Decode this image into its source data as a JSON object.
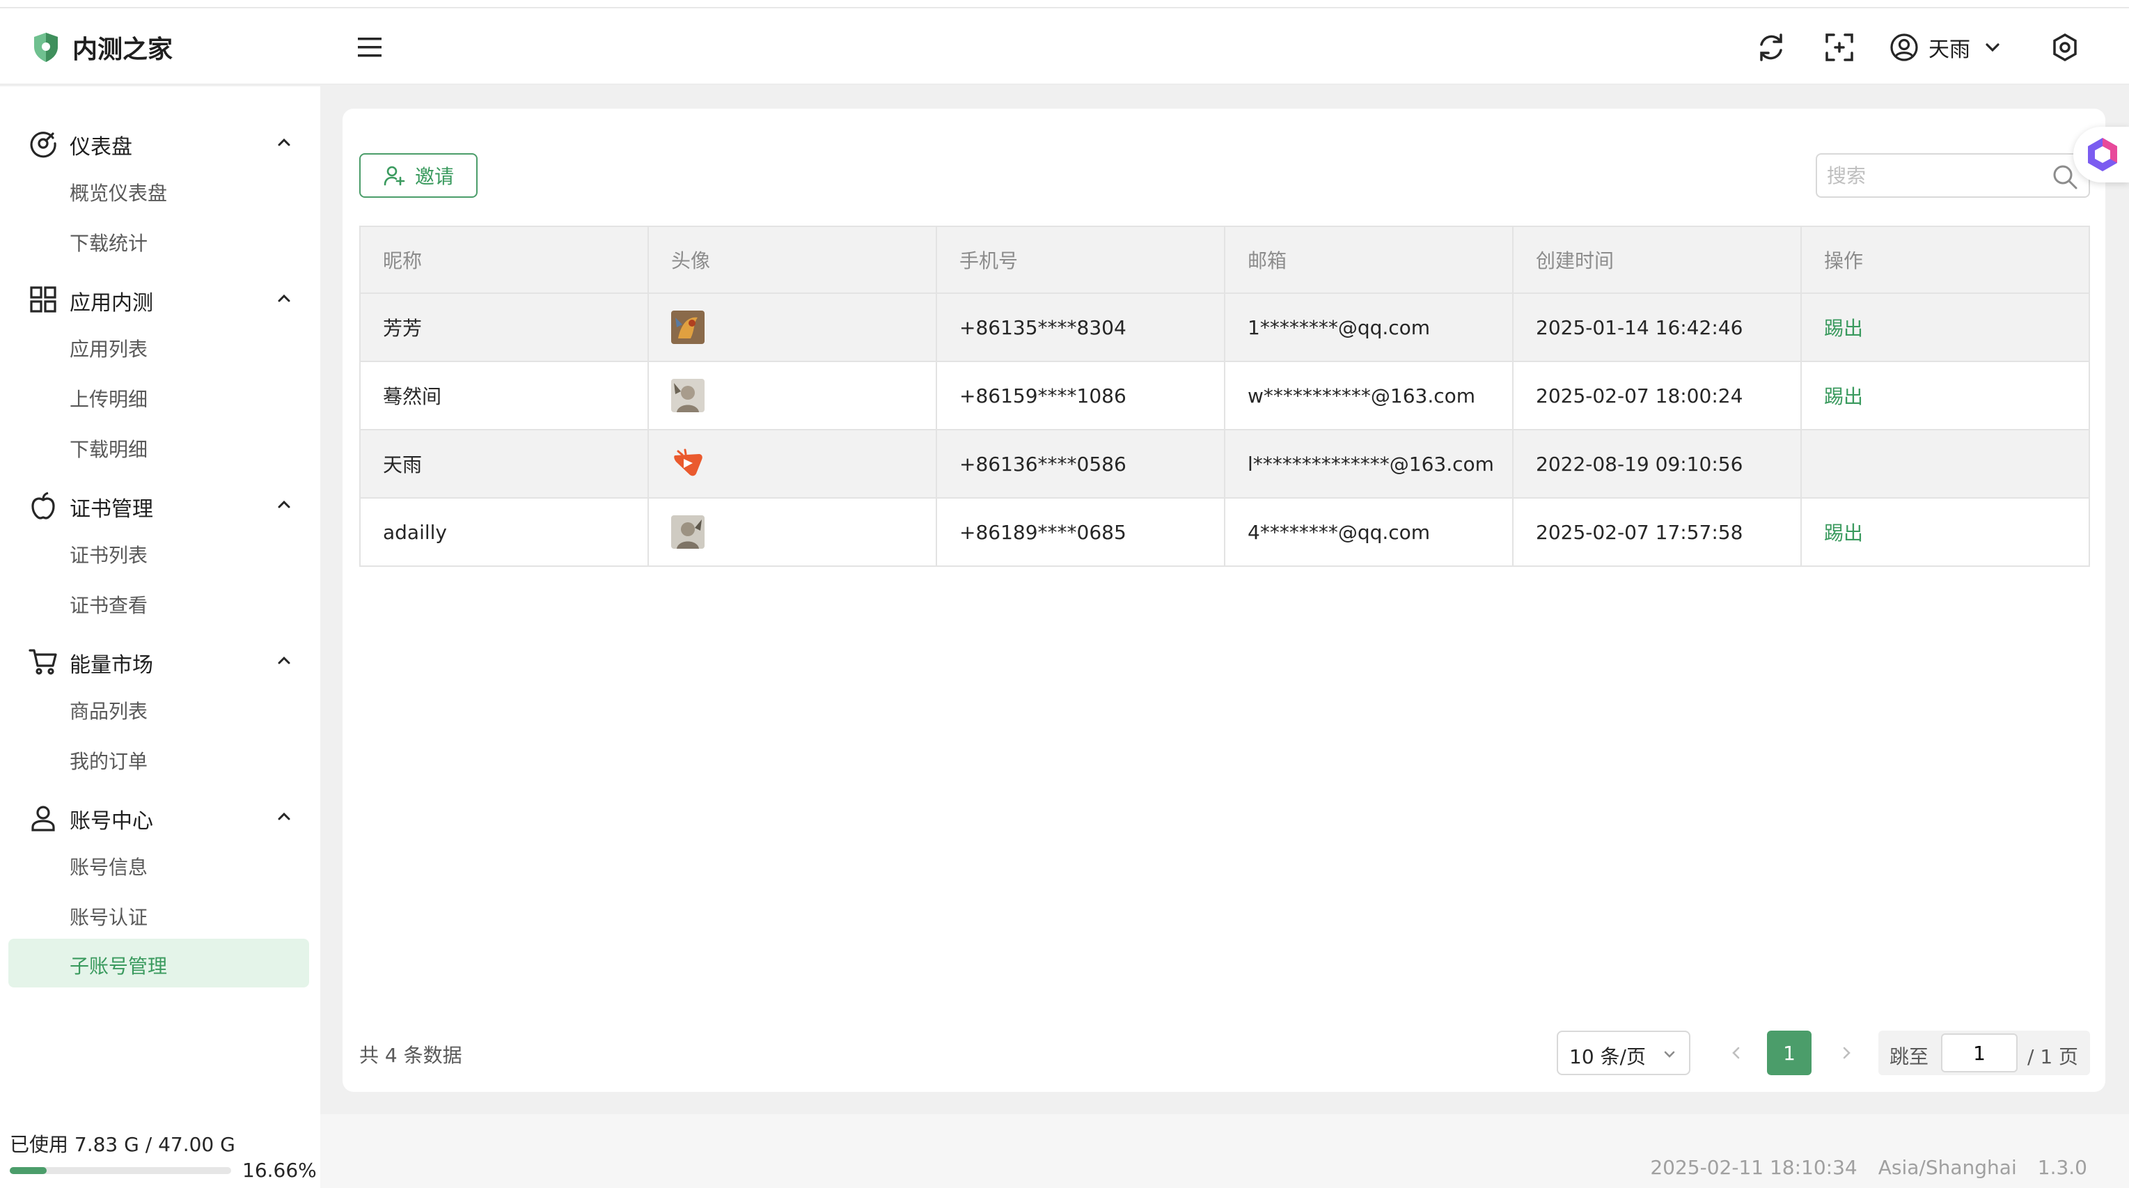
{
  "app": {
    "name": "内测之家"
  },
  "header": {
    "user_name": "天雨"
  },
  "sidebar": {
    "groups": [
      {
        "label": "仪表盘",
        "items": [
          {
            "label": "概览仪表盘"
          },
          {
            "label": "下载统计"
          }
        ]
      },
      {
        "label": "应用内测",
        "items": [
          {
            "label": "应用列表"
          },
          {
            "label": "上传明细"
          },
          {
            "label": "下载明细"
          }
        ]
      },
      {
        "label": "证书管理",
        "items": [
          {
            "label": "证书列表"
          },
          {
            "label": "证书查看"
          }
        ]
      },
      {
        "label": "能量市场",
        "items": [
          {
            "label": "商品列表"
          },
          {
            "label": "我的订单"
          }
        ]
      },
      {
        "label": "账号中心",
        "items": [
          {
            "label": "账号信息"
          },
          {
            "label": "账号认证"
          },
          {
            "label": "子账号管理"
          }
        ]
      }
    ],
    "active_item": "子账号管理"
  },
  "storage": {
    "text": "已使用 7.83 G / 47.00 G",
    "percent_label": "16.66%",
    "fraction": 0.1666
  },
  "toolbar": {
    "invite_label": "邀请"
  },
  "search": {
    "placeholder": "搜索"
  },
  "table": {
    "columns": [
      "昵称",
      "头像",
      "手机号",
      "邮箱",
      "创建时间",
      "操作"
    ],
    "rows": [
      {
        "nickname": "芳芳",
        "avatar": "avatar-dragon-image",
        "phone": "+86135****8304",
        "email": "1********@qq.com",
        "created": "2025-01-14 16:42:46",
        "action": "踢出"
      },
      {
        "nickname": "蓦然间",
        "avatar": "avatar-portrait-image",
        "phone": "+86159****1086",
        "email": "w***********@163.com",
        "created": "2025-02-07 18:00:24",
        "action": "踢出"
      },
      {
        "nickname": "天雨",
        "avatar": "avatar-play-logo",
        "phone": "+86136****0586",
        "email": "l**************@163.com",
        "created": "2022-08-19 09:10:56",
        "action": ""
      },
      {
        "nickname": "adailly",
        "avatar": "avatar-portrait-image",
        "phone": "+86189****0685",
        "email": "4********@qq.com",
        "created": "2025-02-07 17:57:58",
        "action": "踢出"
      }
    ]
  },
  "pagination": {
    "total_text": "共 4 条数据",
    "page_size": "10 条/页",
    "current_page": "1",
    "jump_label": "跳至",
    "jump_value": "1",
    "total_pages": "/ 1 页"
  },
  "footer": {
    "datetime": "2025-02-11 18:10:34",
    "timezone": "Asia/Shanghai",
    "version": "1.3.0"
  },
  "colors": {
    "accent": "#4b9d6a",
    "active_bg": "#e4f4e9"
  }
}
